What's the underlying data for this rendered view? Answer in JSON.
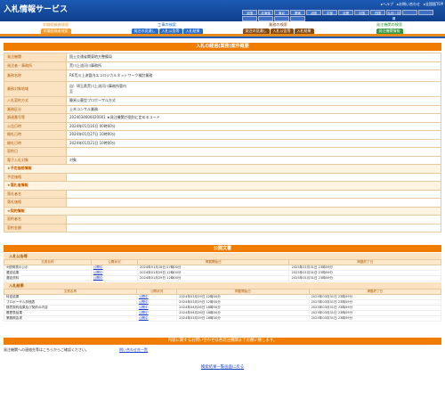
{
  "header": {
    "title": "入札情報サービス",
    "links": [
      "▸ヘルプ",
      "▸お問い合わせ",
      "▸全国版TOP"
    ],
    "regions": [
      "全国",
      "北海道",
      "東北",
      "関東",
      "北陸",
      "中部",
      "近畿",
      "中国",
      "四国",
      "九州・沖縄",
      "",
      "",
      "",
      "",
      "",
      ""
    ]
  },
  "nav": [
    {
      "label": "学識経験者検索",
      "tabs": [
        "学識経験者検索"
      ],
      "color": "#f19b2c"
    },
    {
      "label": "工事の検索",
      "tabs": [
        "発注の見通し",
        "入札公告等",
        "入札結果"
      ],
      "color": "#2a6ec8"
    },
    {
      "label": "業務の検索",
      "tabs": [
        "発注の見通し",
        "入札公告等",
        "入札結果"
      ],
      "color": "#8a4b10"
    },
    {
      "label": "発注機関の検索",
      "tabs": [
        "発注機関情報"
      ],
      "color": "#2e9a3a"
    }
  ],
  "detail": {
    "title": "入札の経過(業務)案件概要",
    "rows": [
      {
        "k": "発注機関",
        "v": "国土交通省関東地方整備局"
      },
      {
        "k": "発注者・事務所",
        "v": "荒川上流河川事務所"
      },
      {
        "k": "業務名称",
        "v": "R6荒川上流管内エコロジカルネットワーク検討業務",
        "cls": "tall"
      },
      {
        "k": "業務対象地域",
        "v": "自）埼玉県荒川上流河川事務所管内\n至",
        "cls": "xtall"
      },
      {
        "k": "入札契約方式",
        "v": "簡易公募型プロポーザル方式"
      },
      {
        "k": "業務区分",
        "v": "土木コンサル業務"
      },
      {
        "k": "調達番号等",
        "v": "2024034600020001      ★発注機関が個別に定めるコード"
      },
      {
        "k": "公告日時",
        "v": "2024年01月16日 00時00分"
      },
      {
        "k": "開札日時",
        "v": "2024年01月27日 10時00分"
      },
      {
        "k": "開札日時",
        "v": "2024年01月21日 10時00分"
      },
      {
        "k": "契約日",
        "v": ""
      },
      {
        "k": "電子入札対象",
        "v": "対象"
      },
      {
        "k": "★予定価格情報",
        "v": "",
        "cls": "sub"
      },
      {
        "k": "予定価格",
        "v": ""
      },
      {
        "k": "★落札者情報",
        "v": "",
        "cls": "sub"
      },
      {
        "k": "落札者名",
        "v": ""
      },
      {
        "k": "落札価格",
        "v": ""
      },
      {
        "k": "★契約情報",
        "v": "",
        "cls": "sub"
      },
      {
        "k": "契約者名",
        "v": ""
      },
      {
        "k": "契約金額",
        "v": ""
      }
    ]
  },
  "docs": {
    "title": "公開文書",
    "headers": [
      "文書名称",
      "公開状況",
      "掲載開始日",
      "掲載終了日"
    ],
    "groups": [
      {
        "label": "入札公告等",
        "rows": [
          [
            "※説明書の公示",
            "公開中",
            "2024年01月16日 07時00分",
            "2025年01月31日 23時59分"
          ],
          [
            "選定結果",
            "公開中",
            "2024年01月29日 12時00分",
            "2025年01月31日 23時59分"
          ],
          [
            "選定資料",
            "公開中",
            "2024年01月29日 12時00分",
            "2025年01月31日 23時59分"
          ]
        ]
      },
      {
        "label": "入札結果",
        "rows": [
          [
            "特定結果",
            "公開中",
            "2024年03月29日 12時00分",
            "2025年03月31日 23時59分"
          ],
          [
            "プロポーザル評価表",
            "公開中",
            "2024年03月29日 12時00分",
            "2025年03月31日 23時59分"
          ],
          [
            "随意契約結果及び契約の内容",
            "公開中",
            "2024年04月26日 18時00分",
            "2025年03月31日 23時59分"
          ],
          [
            "履歴表結果",
            "公開中",
            "2024年04月26日 18時00分",
            "2025年03月31日 23時59分"
          ],
          [
            "業務照会書",
            "公開中",
            "2024年03月29日 18時00分",
            "2025年03月31日 23時59分"
          ]
        ]
      }
    ]
  },
  "footer": {
    "title": "内容に関するお問い合わせは各発注機関までお願い致します。",
    "note": "発注機関への連絡先等はこちらからご確認ください。",
    "contact_link": "問い合わせ先一覧",
    "back_link": "検索結果一覧画面に戻る"
  }
}
